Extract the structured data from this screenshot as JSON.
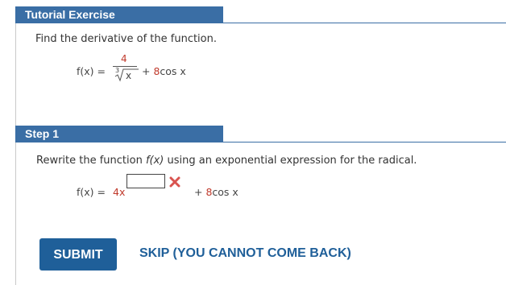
{
  "tutorial": {
    "header": "Tutorial Exercise",
    "prompt": "Find the derivative of the function.",
    "fx_label": "f(x) =",
    "numerator": "4",
    "radical_index": "3",
    "radical_var": "x",
    "plus_term": "+ 8cos x"
  },
  "step1": {
    "header": "Step 1",
    "instruction_pre": "Rewrite the function ",
    "instruction_fx": "f(x)",
    "instruction_post": " using an exponential expression for the radical.",
    "fx_label": "f(x) =",
    "coef": "4x",
    "answer_value": "",
    "plus_term": "+ 8cos x",
    "answer_status": "incorrect"
  },
  "actions": {
    "submit_label": "SUBMIT",
    "skip_label": "SKIP (YOU CANNOT COME BACK)"
  },
  "colors": {
    "header_bg": "#3a6ea5",
    "button_bg": "#1f5f99",
    "math_red": "#c0392b",
    "error_red": "#d9534f"
  }
}
